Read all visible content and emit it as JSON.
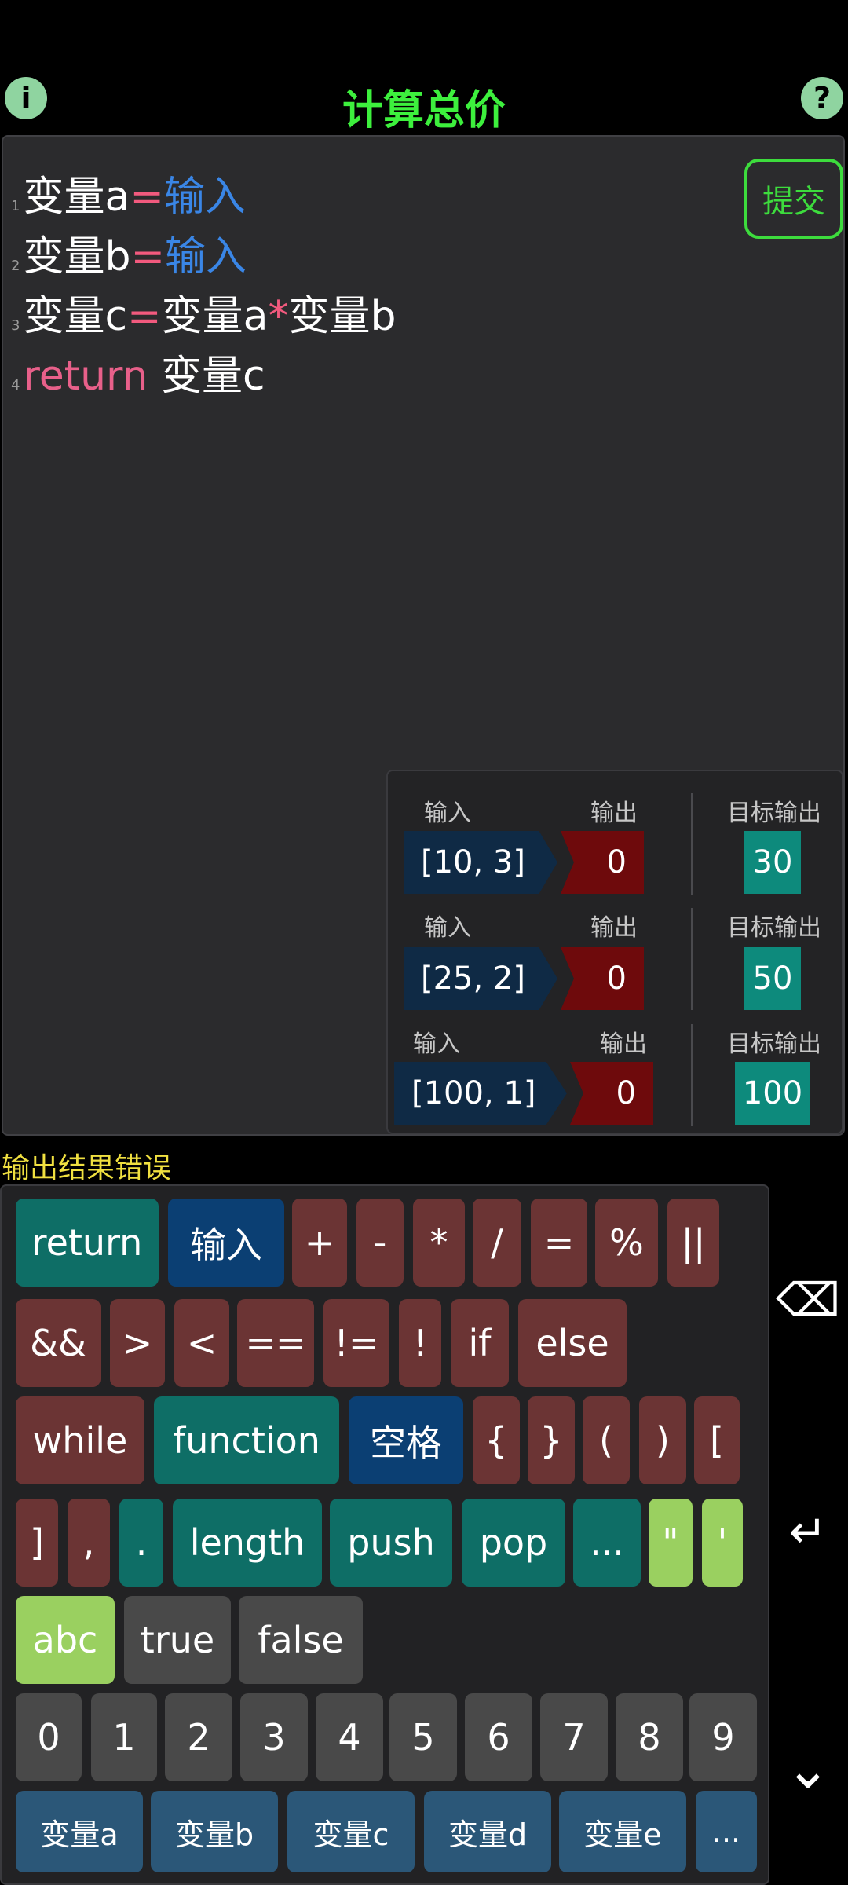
{
  "header": {
    "info_icon": "i",
    "help_icon": "?",
    "title": "计算总价"
  },
  "editor": {
    "lines": [
      {
        "num": "1",
        "a": "变量a",
        "op": "=",
        "b": "输入"
      },
      {
        "num": "2",
        "a": "变量b",
        "op": "=",
        "b": "输入"
      },
      {
        "num": "3",
        "a": "变量c",
        "op": "=",
        "b": "变量a",
        "op2": "*",
        "c": "变量b"
      },
      {
        "num": "4",
        "kw": "return",
        "a": "变量c"
      }
    ],
    "submit_label": "提交"
  },
  "tests": {
    "input_label": "输入",
    "output_label": "输出",
    "target_label": "目标输出",
    "rows": [
      {
        "input": "[10, 3]",
        "output": "0",
        "target": "30"
      },
      {
        "input": "[25, 2]",
        "output": "0",
        "target": "50"
      },
      {
        "input": "[100, 1]",
        "output": "0",
        "target": "100"
      }
    ]
  },
  "status": "输出结果错误",
  "keyboard": {
    "row1": [
      "return",
      "输入",
      "+",
      "-",
      "*",
      "/",
      "=",
      "%",
      "||"
    ],
    "row2": [
      "&&",
      ">",
      "<",
      "==",
      "!=",
      "!",
      "if",
      "else"
    ],
    "row3": [
      "while",
      "function",
      "空格",
      "{",
      "}",
      "(",
      ")",
      "["
    ],
    "row4": [
      "]",
      ",",
      ".",
      "length",
      "push",
      "pop",
      "...",
      "\"",
      "'"
    ],
    "row5": [
      "abc",
      "true",
      "false"
    ],
    "row6": [
      "0",
      "1",
      "2",
      "3",
      "4",
      "5",
      "6",
      "7",
      "8",
      "9"
    ],
    "row7": [
      "变量a",
      "变量b",
      "变量c",
      "变量d",
      "变量e",
      "..."
    ]
  },
  "side": {
    "backspace_icon": "⌫",
    "enter_icon": "↵",
    "collapse_icon": "⌄"
  }
}
